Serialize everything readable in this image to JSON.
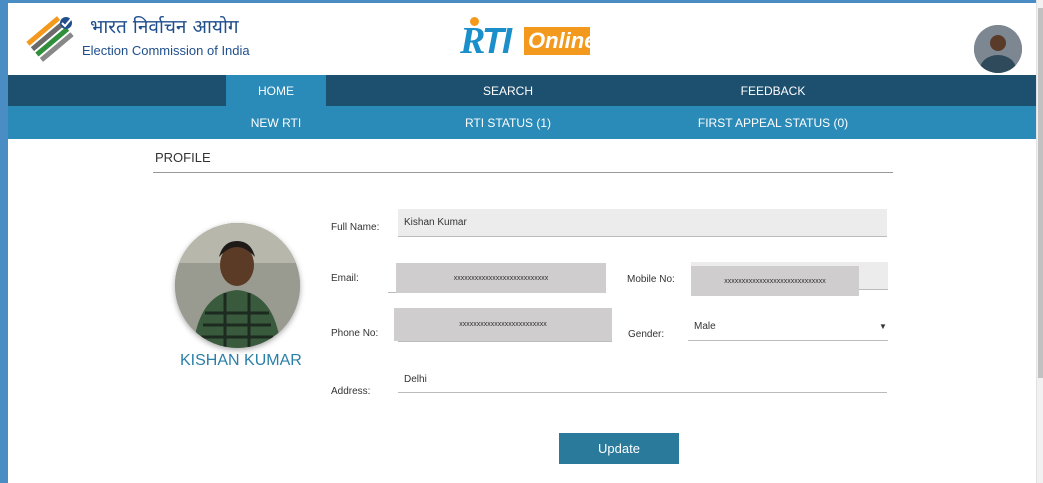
{
  "header": {
    "org_hindi": "भारत निर्वाचन आयोग",
    "org_english": "Election Commission of India",
    "logo_r": "R",
    "logo_ti": "TI",
    "logo_online": "Online"
  },
  "nav": {
    "primary": [
      "HOME",
      "SEARCH",
      "FEEDBACK"
    ],
    "secondary": [
      "NEW RTI",
      "RTI STATUS (1)",
      "FIRST APPEAL STATUS (0)"
    ]
  },
  "profile": {
    "title": "PROFILE",
    "name": "KISHAN KUMAR",
    "labels": {
      "full_name": "Full Name:",
      "email": "Email:",
      "mobile": "Mobile No:",
      "phone": "Phone No:",
      "gender": "Gender:",
      "address": "Address:"
    },
    "values": {
      "full_name": "Kishan Kumar",
      "email": "xxxxxxxxxxxxxxxxxxxxxxxxxxx",
      "mobile": "xxxxxxxxxxxxxxxxxxxxxxxxxxxxx",
      "phone": "xxxxxxxxxxxxxxxxxxxxxxxxx",
      "gender": "Male",
      "address": "Delhi"
    },
    "update_label": "Update"
  },
  "colors": {
    "nav_dark": "#1d4f6f",
    "nav_light": "#2a8ab8",
    "accent_orange": "#f39a1e",
    "button": "#2a7a9c"
  }
}
